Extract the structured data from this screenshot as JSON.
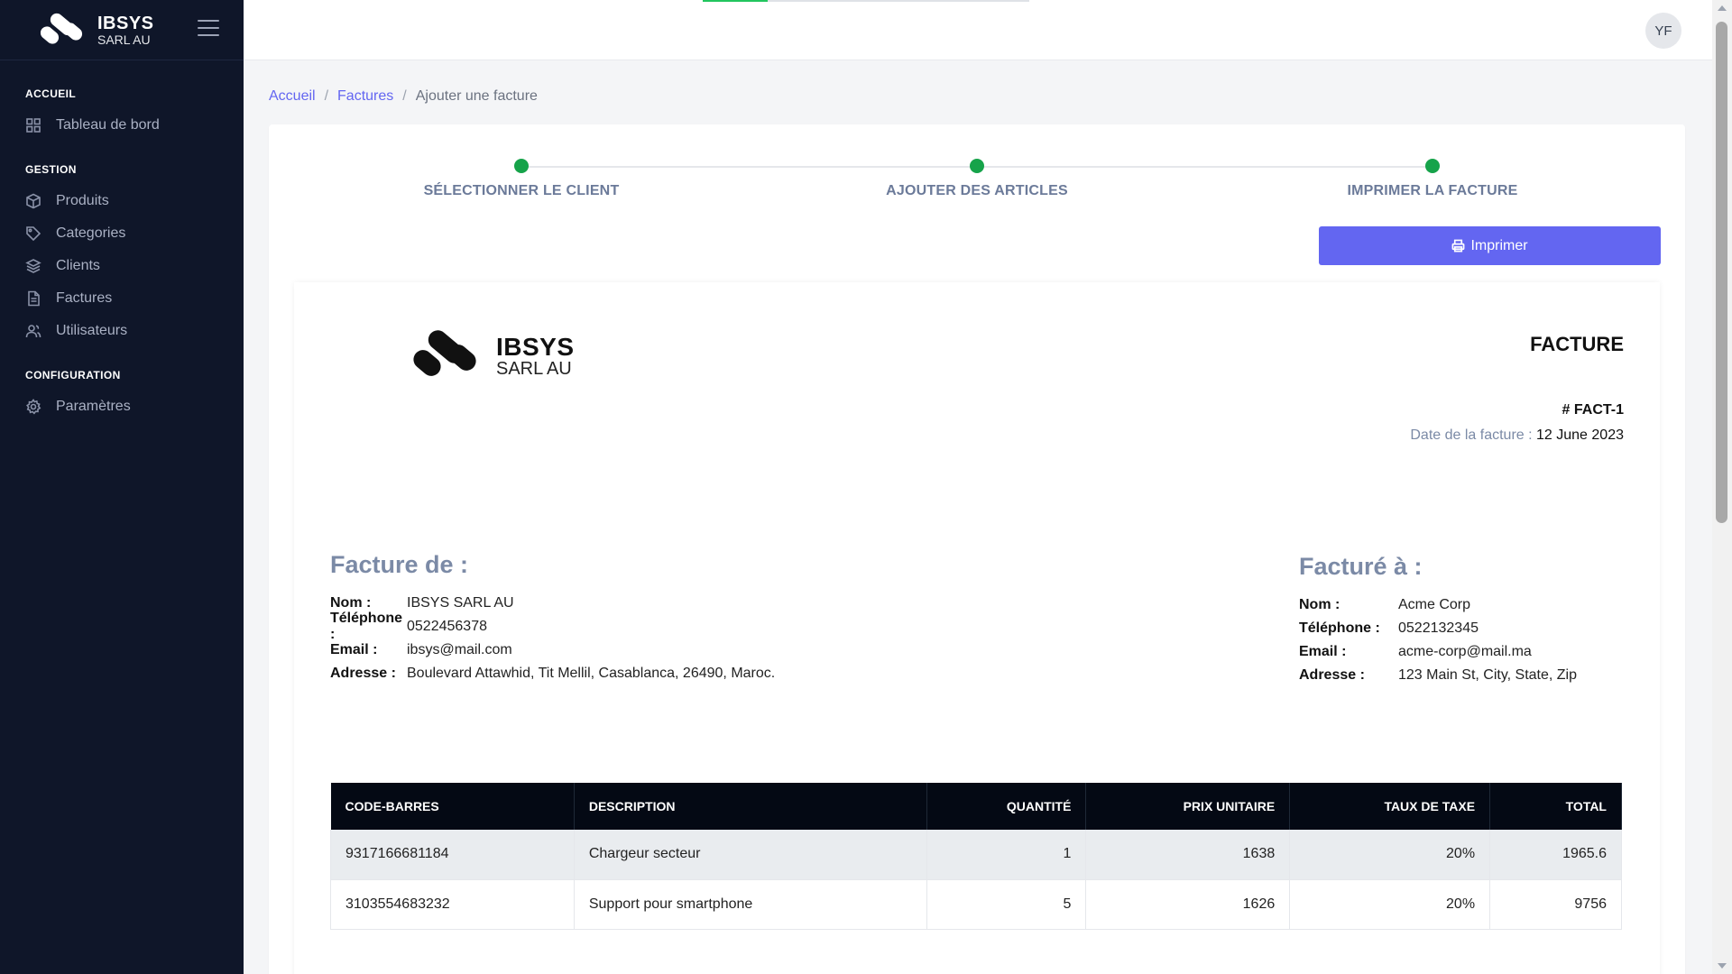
{
  "brand": {
    "name": "IBSYS",
    "sub": "SARL AU"
  },
  "sidebar": {
    "sections": [
      {
        "title": "ACCUEIL",
        "items": [
          {
            "label": "Tableau de bord",
            "icon": "grid-icon"
          }
        ]
      },
      {
        "title": "GESTION",
        "items": [
          {
            "label": "Produits",
            "icon": "box-icon"
          },
          {
            "label": "Categories",
            "icon": "tag-icon"
          },
          {
            "label": "Clients",
            "icon": "layers-icon"
          },
          {
            "label": "Factures",
            "icon": "file-icon"
          },
          {
            "label": "Utilisateurs",
            "icon": "users-icon"
          }
        ]
      },
      {
        "title": "CONFIGURATION",
        "items": [
          {
            "label": "Paramètres",
            "icon": "gear-icon"
          }
        ]
      }
    ]
  },
  "topbar": {
    "avatar_initials": "YF",
    "progress_fraction": 0.2
  },
  "breadcrumb": {
    "home": "Accueil",
    "section": "Factures",
    "current": "Ajouter une facture",
    "separator": "/"
  },
  "stepper": {
    "steps": [
      {
        "label": "SÉLECTIONNER LE CLIENT",
        "done": true
      },
      {
        "label": "AJOUTER DES ARTICLES",
        "done": true
      },
      {
        "label": "IMPRIMER LA FACTURE",
        "done": true
      }
    ]
  },
  "print_button": {
    "label": "Imprimer",
    "icon": "printer-icon"
  },
  "invoice": {
    "title": "FACTURE",
    "number": "# FACT-1",
    "date_label": "Date de la facture :",
    "date_value": "12 June 2023",
    "from": {
      "heading": "Facture de :",
      "rows": [
        {
          "label": "Nom :",
          "value": "IBSYS SARL AU"
        },
        {
          "label": "Téléphone :",
          "value": "0522456378"
        },
        {
          "label": "Email :",
          "value": "ibsys@mail.com"
        },
        {
          "label": "Adresse :",
          "value": "Boulevard Attawhid, Tit Mellil, Casablanca, 26490, Maroc."
        }
      ]
    },
    "to": {
      "heading": "Facturé à :",
      "rows": [
        {
          "label": "Nom :",
          "value": "Acme Corp"
        },
        {
          "label": "Téléphone :",
          "value": "0522132345"
        },
        {
          "label": "Email :",
          "value": "acme-corp@mail.ma"
        },
        {
          "label": "Adresse :",
          "value": "123 Main St, City, State, Zip"
        }
      ]
    },
    "table": {
      "headers": [
        "CODE-BARRES",
        "DESCRIPTION",
        "QUANTITÉ",
        "PRIX UNITAIRE",
        "TAUX DE TAXE",
        "TOTAL"
      ],
      "rows": [
        [
          "9317166681184",
          "Chargeur secteur",
          "1",
          "1638",
          "20%",
          "1965.6"
        ],
        [
          "3103554683232",
          "Support pour smartphone",
          "5",
          "1626",
          "20%",
          "9756"
        ]
      ]
    }
  },
  "colors": {
    "accent": "#6366f1",
    "sidebar_bg": "#0f1629",
    "step_done": "#16a34a",
    "table_header": "#040914"
  }
}
